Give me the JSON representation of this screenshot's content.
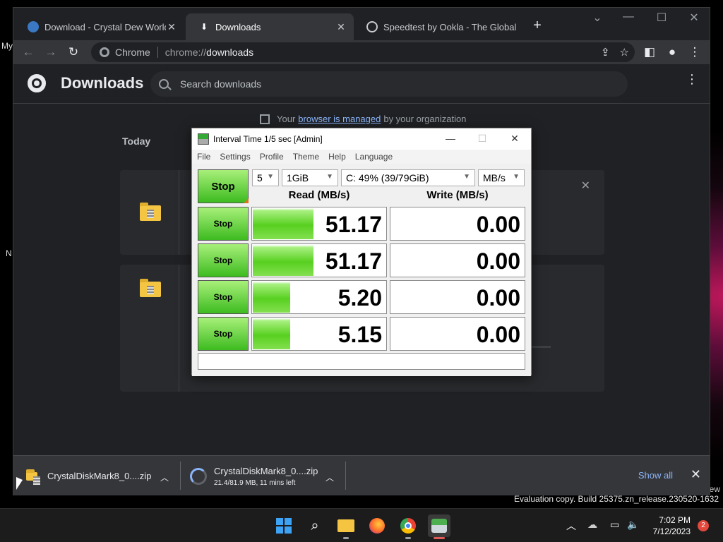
{
  "desktop": {
    "labels": [
      "My",
      "N"
    ],
    "watermark_line1": "ew",
    "watermark_line2": "Evaluation copy. Build 25375.zn_release.230520-1632"
  },
  "chrome": {
    "tabs": [
      {
        "title": "Download - Crystal Dew World [",
        "icon": "globe-icon"
      },
      {
        "title": "Downloads",
        "icon": "download-icon"
      },
      {
        "title": "Speedtest by Ookla - The Global",
        "icon": "speedtest-icon"
      }
    ],
    "omnibox": {
      "chip": "Chrome",
      "scheme": "chrome://",
      "host": "downloads"
    }
  },
  "downloads_page": {
    "title": "Downloads",
    "search_placeholder": "Search downloads",
    "managed_prefix": "Your",
    "managed_link": "browser is managed",
    "managed_suffix": "by your organization",
    "section": "Today"
  },
  "shelf": {
    "items": [
      {
        "name": "CrystalDiskMark8_0....zip",
        "sub": ""
      },
      {
        "name": "CrystalDiskMark8_0....zip",
        "sub": "21.4/81.9 MB, 11 mins left"
      }
    ],
    "show_all": "Show all"
  },
  "cdm": {
    "title": "Interval Time 1/5 sec [Admin]",
    "menu": [
      "File",
      "Settings",
      "Profile",
      "Theme",
      "Help",
      "Language"
    ],
    "main_button": "Stop",
    "count": "5",
    "size": "1GiB",
    "drive": "C: 49% (39/79GiB)",
    "unit": "MB/s",
    "read_header": "Read (MB/s)",
    "write_header": "Write (MB/s)",
    "rows": [
      {
        "button": "Stop",
        "read": "51.17",
        "write": "0.00",
        "read_fill": 0.45,
        "write_fill": 0
      },
      {
        "button": "Stop",
        "read": "51.17",
        "write": "0.00",
        "read_fill": 0.45,
        "write_fill": 0
      },
      {
        "button": "Stop",
        "read": "5.20",
        "write": "0.00",
        "read_fill": 0.28,
        "write_fill": 0
      },
      {
        "button": "Stop",
        "read": "5.15",
        "write": "0.00",
        "read_fill": 0.28,
        "write_fill": 0
      }
    ],
    "comment": ""
  },
  "taskbar": {
    "time": "7:02 PM",
    "date": "7/12/2023",
    "notifications": "2",
    "apps": [
      "start-icon",
      "search-icon",
      "file-explorer-icon",
      "firefox-icon",
      "chrome-icon",
      "crystaldiskmark-icon"
    ]
  }
}
